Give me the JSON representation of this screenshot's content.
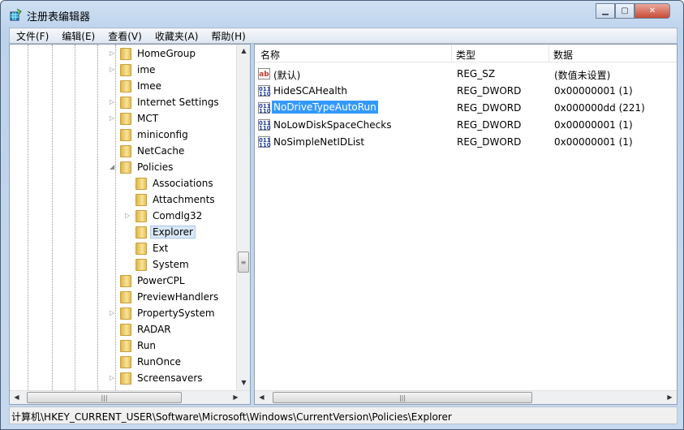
{
  "window": {
    "title": "注册表编辑器",
    "icon": "regedit-icon",
    "minimize": "minimize-icon",
    "maximize": "maximize-icon",
    "close": "close-icon"
  },
  "menu": [
    "文件(F)",
    "编辑(E)",
    "查看(V)",
    "收藏夹(A)",
    "帮助(H)"
  ],
  "tree": [
    {
      "label": "HomeGroup",
      "level": 1,
      "expandable": true
    },
    {
      "label": "ime",
      "level": 1,
      "expandable": true
    },
    {
      "label": "Imee",
      "level": 1,
      "expandable": false
    },
    {
      "label": "Internet Settings",
      "level": 1,
      "expandable": true
    },
    {
      "label": "MCT",
      "level": 1,
      "expandable": true
    },
    {
      "label": "miniconfig",
      "level": 1,
      "expandable": false
    },
    {
      "label": "NetCache",
      "level": 1,
      "expandable": false
    },
    {
      "label": "Policies",
      "level": 1,
      "expanded": true
    },
    {
      "label": "Associations",
      "level": 2,
      "expandable": false
    },
    {
      "label": "Attachments",
      "level": 2,
      "expandable": false
    },
    {
      "label": "Comdlg32",
      "level": 2,
      "expandable": true
    },
    {
      "label": "Explorer",
      "level": 2,
      "selected": true
    },
    {
      "label": "Ext",
      "level": 2,
      "expandable": false
    },
    {
      "label": "System",
      "level": 2,
      "expandable": false
    },
    {
      "label": "PowerCPL",
      "level": 1,
      "expandable": false
    },
    {
      "label": "PreviewHandlers",
      "level": 1,
      "expandable": false
    },
    {
      "label": "PropertySystem",
      "level": 1,
      "expandable": true
    },
    {
      "label": "RADAR",
      "level": 1,
      "expandable": false
    },
    {
      "label": "Run",
      "level": 1,
      "expandable": false
    },
    {
      "label": "RunOnce",
      "level": 1,
      "expandable": false
    },
    {
      "label": "Screensavers",
      "level": 1,
      "expandable": true
    }
  ],
  "list": {
    "columns": [
      "名称",
      "类型",
      "数据"
    ],
    "rows": [
      {
        "name": "(默认)",
        "type": "REG_SZ",
        "data": "(数值未设置)",
        "icon": "ab"
      },
      {
        "name": "HideSCAHealth",
        "type": "REG_DWORD",
        "data": "0x00000001 (1)",
        "icon": "dword"
      },
      {
        "name": "NoDriveTypeAutoRun",
        "type": "REG_DWORD",
        "data": "0x000000dd (221)",
        "icon": "dword",
        "selected": true
      },
      {
        "name": "NoLowDiskSpaceChecks",
        "type": "REG_DWORD",
        "data": "0x00000001 (1)",
        "icon": "dword"
      },
      {
        "name": "NoSimpleNetIDList",
        "type": "REG_DWORD",
        "data": "0x00000001 (1)",
        "icon": "dword"
      }
    ]
  },
  "status": "计算机\\HKEY_CURRENT_USER\\Software\\Microsoft\\Windows\\CurrentVersion\\Policies\\Explorer"
}
